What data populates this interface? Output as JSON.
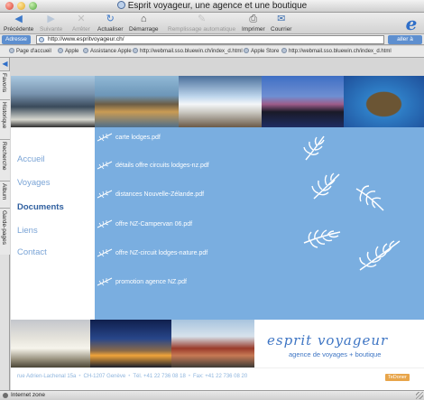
{
  "window": {
    "title": "Esprit voyageur, une agence et une boutique"
  },
  "toolbar": {
    "buttons": [
      {
        "label": "Précédente",
        "icon": "back-arrow-icon",
        "enabled": true
      },
      {
        "label": "Suivante",
        "icon": "forward-arrow-icon",
        "enabled": false
      },
      {
        "label": "Arrêter",
        "icon": "stop-icon",
        "enabled": false
      },
      {
        "label": "Actualiser",
        "icon": "refresh-icon",
        "enabled": true
      },
      {
        "label": "Démarrage",
        "icon": "home-icon",
        "enabled": true
      },
      {
        "label": "Remplissage automatique",
        "icon": "autofill-icon",
        "enabled": false
      },
      {
        "label": "Imprimer",
        "icon": "print-icon",
        "enabled": true
      },
      {
        "label": "Courrier",
        "icon": "mail-icon",
        "enabled": true
      }
    ]
  },
  "address": {
    "label": "Adresse",
    "url": "http://www.espritvoyageur.ch/",
    "go": "aller à"
  },
  "favorites": [
    "Page d'accueil",
    "Apple",
    "Assistance Apple",
    "http://webmail.sso.bluewin.ch/index_d.html",
    "Apple Store",
    "http://webmail.sso.bluewin.ch/index_d.html"
  ],
  "explorer_tabs": [
    "Favoris",
    "Historique",
    "Recherche",
    "Album",
    "Garde-pages"
  ],
  "site": {
    "nav": [
      "Accueil",
      "Voyages",
      "Documents",
      "Liens",
      "Contact"
    ],
    "active_nav": "Documents",
    "documents": [
      "carte lodges.pdf",
      "détails offre circuits lodges-nz.pdf",
      "distances Nouvelle-Zélande.pdf",
      "offre NZ-Campervan 06.pdf",
      "offre NZ-circuit lodges-nature.pdf",
      "promotion agence NZ.pdf"
    ],
    "logo": {
      "name": "esprit voyageur",
      "tagline": "agence de voyages + boutique"
    },
    "footer": {
      "street": "rue Adrien-Lachenal 15a",
      "city": "CH-1207 Genève",
      "tel": "Tél. +41 22 736 08 18",
      "fax": "Fax: +41 22 736 08 20",
      "badge": "TeDoner"
    },
    "colors": {
      "panel": "#7aaee0",
      "nav": "#7aa4d6",
      "nav_active": "#2f5f9f"
    }
  },
  "status": {
    "text": "Internet zone"
  }
}
